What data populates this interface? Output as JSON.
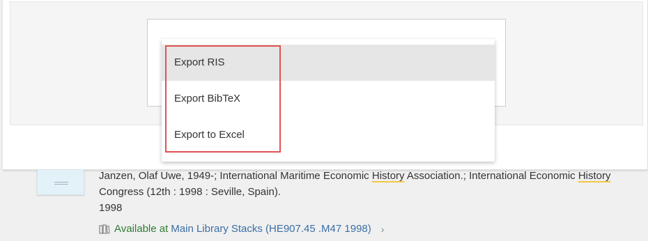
{
  "export_menu": {
    "items": [
      {
        "label": "Export RIS",
        "active": true
      },
      {
        "label": "Export BibTeX",
        "active": false
      },
      {
        "label": "Export to Excel",
        "active": false
      }
    ]
  },
  "record": {
    "authors_pre1": "Janzen, Olaf Uwe, 1949-; International Maritime Economic ",
    "hl1": "History",
    "authors_mid": " Association.; International Economic ",
    "hl2": "History",
    "authors_post": " Congress (12th : 1998 : Seville, Spain).",
    "year": "1998",
    "availability": {
      "status": "Available at",
      "location": "Main Library",
      "detail": "Stacks (HE907.45 .M47 1998)"
    }
  },
  "icons": {
    "book": "book-icon",
    "chevron": "chevron-right-icon"
  },
  "colors": {
    "highlight_box": "#e05252",
    "available_text": "#2e7d32",
    "link_text": "#3a6ea5",
    "search_highlight": "#f3c846"
  }
}
